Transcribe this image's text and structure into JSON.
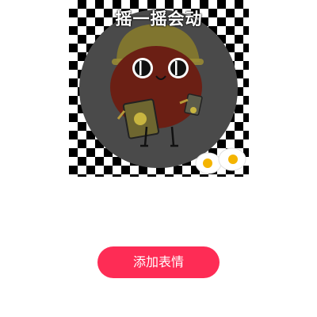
{
  "sticker": {
    "caption": "摇一摇会动",
    "character": "smiling-tomato-hardhat-character"
  },
  "actions": {
    "add_label": "添加表情"
  },
  "colors": {
    "accent": "#fe2c55",
    "overlay": "#4a4a4a",
    "character_body": "#6b1f14",
    "hardhat": "#8a7d2a"
  }
}
